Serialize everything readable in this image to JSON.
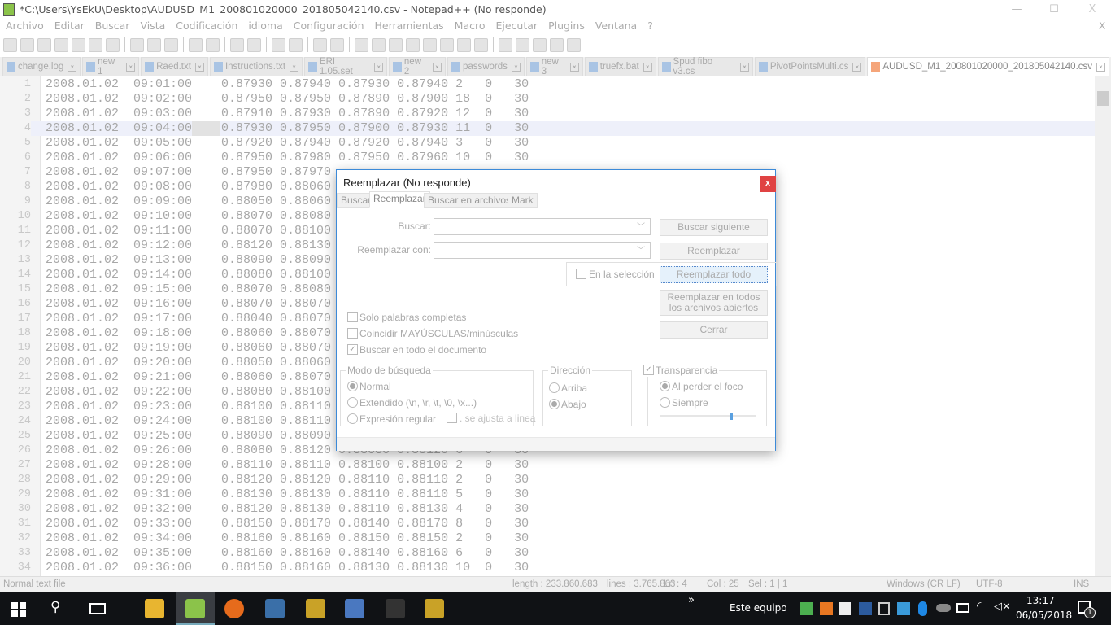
{
  "window": {
    "title": "*C:\\Users\\YsEkU\\Desktop\\AUDUSD_M1_200801020000_201805042140.csv - Notepad++ (No responde)",
    "minimize": "—",
    "maximize": "☐",
    "close": "X"
  },
  "menu": [
    "Archivo",
    "Editar",
    "Buscar",
    "Vista",
    "Codificación",
    "idioma",
    "Configuración",
    "Herramientas",
    "Macro",
    "Ejecutar",
    "Plugins",
    "Ventana",
    "?"
  ],
  "menu_right_close": "X",
  "tabs": [
    {
      "label": "change.log"
    },
    {
      "label": "new 1"
    },
    {
      "label": "Raed.txt"
    },
    {
      "label": "Instructions.txt"
    },
    {
      "label": "ERI 1.05.set"
    },
    {
      "label": "new 2"
    },
    {
      "label": "passwords"
    },
    {
      "label": "new 3"
    },
    {
      "label": "truefx.bat"
    },
    {
      "label": "Spud fibo v3.cs"
    },
    {
      "label": "PivotPointsMulti.cs"
    },
    {
      "label": "AUDUSD_M1_200801020000_201805042140.csv",
      "active": true
    }
  ],
  "editor": {
    "current_line": 4,
    "rows": [
      [
        "2008.01.02",
        "09:01:00",
        "0.87930",
        "0.87940",
        "0.87930",
        "0.87940",
        "2",
        "0",
        "30"
      ],
      [
        "2008.01.02",
        "09:02:00",
        "0.87950",
        "0.87950",
        "0.87890",
        "0.87900",
        "18",
        "0",
        "30"
      ],
      [
        "2008.01.02",
        "09:03:00",
        "0.87910",
        "0.87930",
        "0.87890",
        "0.87920",
        "12",
        "0",
        "30"
      ],
      [
        "2008.01.02",
        "09:04:00",
        "0.87930",
        "0.87950",
        "0.87900",
        "0.87930",
        "11",
        "0",
        "30"
      ],
      [
        "2008.01.02",
        "09:05:00",
        "0.87920",
        "0.87940",
        "0.87920",
        "0.87940",
        "3",
        "0",
        "30"
      ],
      [
        "2008.01.02",
        "09:06:00",
        "0.87950",
        "0.87980",
        "0.87950",
        "0.87960",
        "10",
        "0",
        "30"
      ],
      [
        "2008.01.02",
        "09:07:00",
        "0.87950",
        "0.87970"
      ],
      [
        "2008.01.02",
        "09:08:00",
        "0.87980",
        "0.88060"
      ],
      [
        "2008.01.02",
        "09:09:00",
        "0.88050",
        "0.88060"
      ],
      [
        "2008.01.02",
        "09:10:00",
        "0.88070",
        "0.88080"
      ],
      [
        "2008.01.02",
        "09:11:00",
        "0.88070",
        "0.88100"
      ],
      [
        "2008.01.02",
        "09:12:00",
        "0.88120",
        "0.88130"
      ],
      [
        "2008.01.02",
        "09:13:00",
        "0.88090",
        "0.88090"
      ],
      [
        "2008.01.02",
        "09:14:00",
        "0.88080",
        "0.88100"
      ],
      [
        "2008.01.02",
        "09:15:00",
        "0.88070",
        "0.88080"
      ],
      [
        "2008.01.02",
        "09:16:00",
        "0.88070",
        "0.88070"
      ],
      [
        "2008.01.02",
        "09:17:00",
        "0.88040",
        "0.88070"
      ],
      [
        "2008.01.02",
        "09:18:00",
        "0.88060",
        "0.88070"
      ],
      [
        "2008.01.02",
        "09:19:00",
        "0.88060",
        "0.88070"
      ],
      [
        "2008.01.02",
        "09:20:00",
        "0.88050",
        "0.88060"
      ],
      [
        "2008.01.02",
        "09:21:00",
        "0.88060",
        "0.88070"
      ],
      [
        "2008.01.02",
        "09:22:00",
        "0.88080",
        "0.88100"
      ],
      [
        "2008.01.02",
        "09:23:00",
        "0.88100",
        "0.88110"
      ],
      [
        "2008.01.02",
        "09:24:00",
        "0.88100",
        "0.88110"
      ],
      [
        "2008.01.02",
        "09:25:00",
        "0.88090",
        "0.88090"
      ],
      [
        "2008.01.02",
        "09:26:00",
        "0.88080",
        "0.88120",
        "0.88080",
        "0.88120",
        "6",
        "0",
        "30"
      ],
      [
        "2008.01.02",
        "09:28:00",
        "0.88110",
        "0.88110",
        "0.88100",
        "0.88100",
        "2",
        "0",
        "30"
      ],
      [
        "2008.01.02",
        "09:29:00",
        "0.88120",
        "0.88120",
        "0.88110",
        "0.88110",
        "2",
        "0",
        "30"
      ],
      [
        "2008.01.02",
        "09:31:00",
        "0.88130",
        "0.88130",
        "0.88110",
        "0.88110",
        "5",
        "0",
        "30"
      ],
      [
        "2008.01.02",
        "09:32:00",
        "0.88120",
        "0.88130",
        "0.88110",
        "0.88130",
        "4",
        "0",
        "30"
      ],
      [
        "2008.01.02",
        "09:33:00",
        "0.88150",
        "0.88170",
        "0.88140",
        "0.88170",
        "8",
        "0",
        "30"
      ],
      [
        "2008.01.02",
        "09:34:00",
        "0.88160",
        "0.88160",
        "0.88150",
        "0.88150",
        "2",
        "0",
        "30"
      ],
      [
        "2008.01.02",
        "09:35:00",
        "0.88160",
        "0.88160",
        "0.88140",
        "0.88160",
        "6",
        "0",
        "30"
      ],
      [
        "2008.01.02",
        "09:36:00",
        "0.88150",
        "0.88160",
        "0.88130",
        "0.88130",
        "10",
        "0",
        "30"
      ]
    ]
  },
  "status": {
    "type": "Normal text file",
    "length": "length : 233.860.683",
    "lines": "lines : 3.765.863",
    "ln": "Ln : 4",
    "col": "Col : 25",
    "sel": "Sel : 1 | 1",
    "eol": "Windows (CR LF)",
    "encoding": "UTF-8",
    "mode": "INS"
  },
  "dialog": {
    "title": "Reemplazar (No responde)",
    "close": "x",
    "tabs": [
      "Buscar",
      "Reemplazar",
      "Buscar en archivos",
      "Mark"
    ],
    "active_tab": "Reemplazar",
    "find_label": "Buscar:",
    "find_value": "",
    "replace_label": "Reemplazar con:",
    "replace_value": "",
    "in_selection": {
      "label": "En la selección",
      "checked": false
    },
    "buttons": {
      "find_next": "Buscar siguiente",
      "replace": "Reemplazar",
      "replace_all": "Reemplazar todo",
      "replace_all_open": "Reemplazar en todos los archivos abiertos",
      "close": "Cerrar"
    },
    "options": [
      {
        "label": "Solo palabras completas",
        "checked": false
      },
      {
        "label": "Coincidir MAYÚSCULAS/minúsculas",
        "checked": false
      },
      {
        "label": "Buscar en todo el documento",
        "checked": true
      }
    ],
    "search_mode": {
      "title": "Modo de búsqueda",
      "options": [
        "Normal",
        "Extendido (\\n, \\r, \\t, \\0, \\x...)",
        "Expresión regular"
      ],
      "selected": "Normal",
      "dot_newline": {
        "label": ". se ajusta a linea",
        "checked": false
      }
    },
    "direction": {
      "title": "Dirección",
      "options": [
        "Arriba",
        "Abajo"
      ],
      "selected": "Abajo"
    },
    "transparency": {
      "label": "Transparencia",
      "checked": true,
      "options": [
        "Al perder el foco",
        "Siempre"
      ],
      "selected": "Al perder el foco",
      "level": 0.75
    }
  },
  "taskbar": {
    "chevron": "»",
    "location": "Este equipo",
    "time": "13:17",
    "date": "06/05/2018",
    "notifications": "1"
  }
}
